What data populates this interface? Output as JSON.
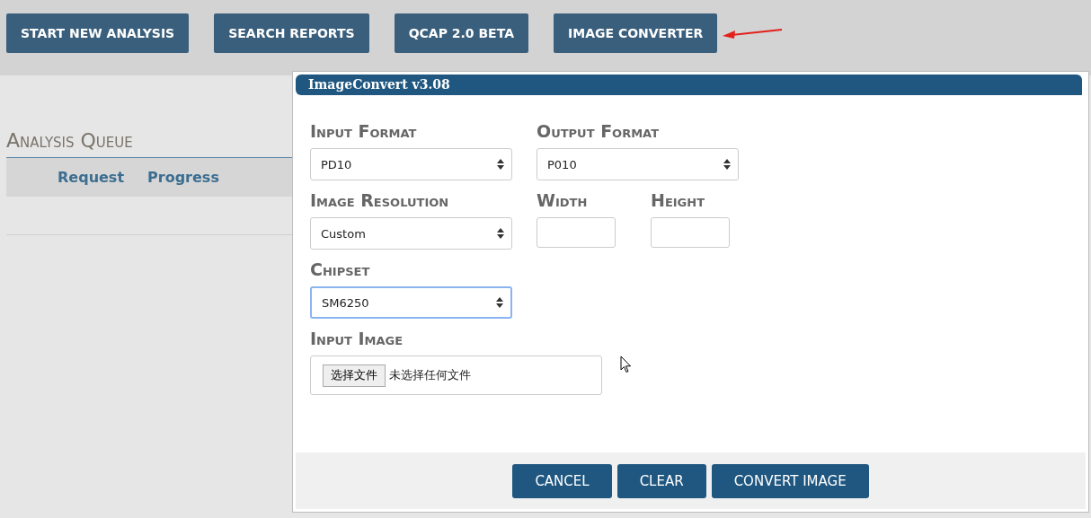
{
  "nav_buttons": [
    {
      "label": "START NEW ANALYSIS"
    },
    {
      "label": "SEARCH REPORTS"
    },
    {
      "label": "QCAP 2.0 BETA"
    },
    {
      "label": "IMAGE CONVERTER"
    }
  ],
  "queue": {
    "title": "Analysis Queue",
    "columns": [
      "Request",
      "Progress"
    ]
  },
  "dialog": {
    "title": "ImageConvert v3.08",
    "rows": [
      [
        {
          "kind": "select",
          "label": "Input Format",
          "value": "PD10",
          "focused": false
        },
        {
          "kind": "select",
          "label": "Output Format",
          "value": "P010",
          "focused": false
        }
      ],
      [
        {
          "kind": "select",
          "label": "Image Resolution",
          "value": "Custom",
          "focused": false
        },
        {
          "kind": "input",
          "label": "Width"
        },
        {
          "kind": "input",
          "label": "Height"
        }
      ],
      [
        {
          "kind": "select",
          "label": "Chipset",
          "value": "SM6250",
          "focused": true
        }
      ],
      [
        {
          "kind": "file",
          "label": "Input Image",
          "button": "选择文件",
          "status": "未选择任何文件"
        }
      ]
    ],
    "buttons": [
      "CANCEL",
      "CLEAR",
      "CONVERT IMAGE"
    ]
  }
}
